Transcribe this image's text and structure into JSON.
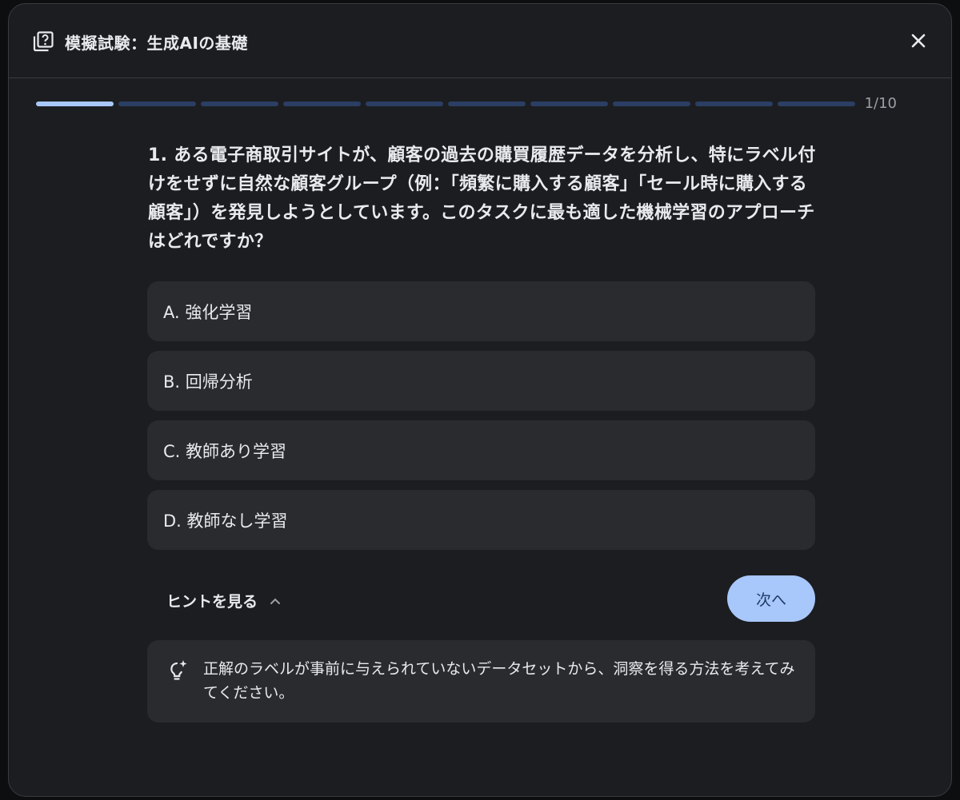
{
  "header": {
    "title": "模擬試験：生成AIの基礎",
    "icon": "quiz-icon",
    "close_icon": "close-icon"
  },
  "progress": {
    "current": 1,
    "total": 10,
    "label": "1/10"
  },
  "question": {
    "text": "1. ある電子商取引サイトが、顧客の過去の購買履歴データを分析し、特にラベル付けをせずに自然な顧客グループ（例：「頻繁に購入する顧客」「セール時に購入する顧客」）を発見しようとしています。このタスクに最も適した機械学習のアプローチはどれですか？"
  },
  "options": [
    {
      "label": "A.  強化学習"
    },
    {
      "label": "B.  回帰分析"
    },
    {
      "label": "C.  教師あり学習"
    },
    {
      "label": "D.  教師なし学習"
    }
  ],
  "hint": {
    "toggle_label": "ヒントを見る",
    "toggle_icon": "chevron-up-icon",
    "icon": "lightbulb-sparkle-icon",
    "text": "正解のラベルが事前に与えられていないデータセットから、洞察を得る方法を考えてみてください。"
  },
  "next_button": {
    "label": "次へ"
  },
  "colors": {
    "accent": "#a8c7fa",
    "progress_inactive": "#2b3e63",
    "surface": "#1c1d20",
    "card": "#2a2b2e"
  }
}
